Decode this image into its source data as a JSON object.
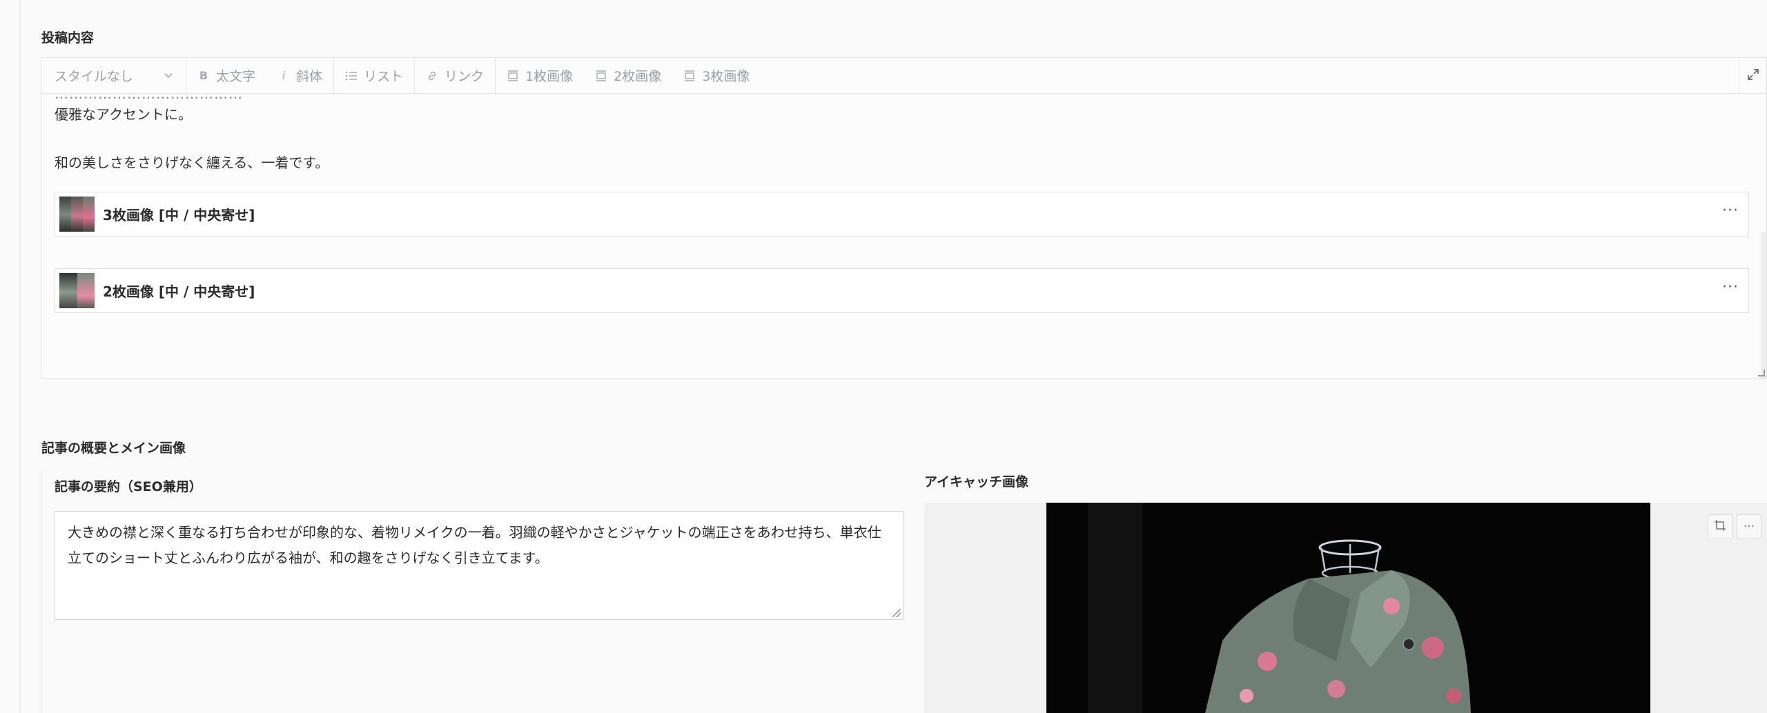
{
  "content_section": {
    "title": "投稿内容",
    "toolbar": {
      "style_select": "スタイルなし",
      "bold": "太文字",
      "italic": "斜体",
      "list": "リスト",
      "link": "リンク",
      "image1": "1枚画像",
      "image2": "2枚画像",
      "image3": "3枚画像"
    },
    "cutoff_line": "…………………………………",
    "paragraphs": [
      "優雅なアクセントに。",
      "和の美しさをさりげなく纏える、一着です。"
    ],
    "blocks": [
      {
        "label": "3枚画像 [中 / 中央寄せ]",
        "more": "···"
      },
      {
        "label": "2枚画像 [中 / 中央寄せ]",
        "more": "···"
      }
    ]
  },
  "overview_section": {
    "title": "記事の概要とメイン画像",
    "summary_label": "記事の要約（SEO兼用）",
    "summary_text": "大きめの襟と深く重なる打ち合わせが印象的な、着物リメイクの一着。羽織の軽やかさとジャケットの端正さをあわせ持ち、単衣仕立てのショート丈とふんわり広がる袖が、和の趣をさりげなく引き立てます。",
    "featured_label": "アイキャッチ画像",
    "featured_more": "···"
  },
  "icons": [
    "chevron-down-icon",
    "bold-icon",
    "italic-icon",
    "list-icon",
    "link-icon",
    "image-icon",
    "expand-icon",
    "crop-icon",
    "more-icon"
  ]
}
